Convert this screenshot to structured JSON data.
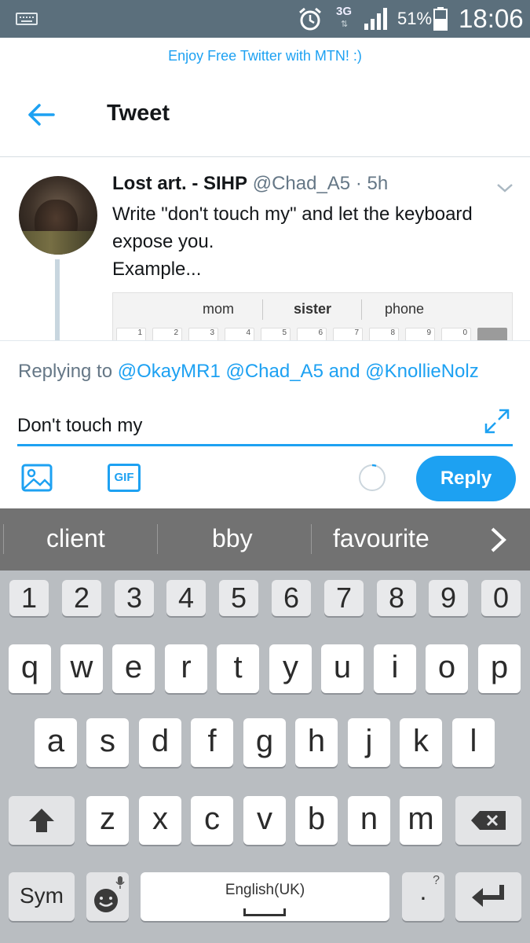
{
  "status_bar": {
    "network": "3G",
    "battery": "51%",
    "time": "18:06"
  },
  "banner": {
    "text": "Enjoy Free Twitter with MTN! :)"
  },
  "header": {
    "title": "Tweet"
  },
  "tweet": {
    "name": "Lost art. - SIHP",
    "handle": "@Chad_A5",
    "time": "5h",
    "lines": [
      "Write \"don't touch my\" and let the keyboard",
      "expose you.",
      "Example..."
    ],
    "image": {
      "suggestions": [
        "mom",
        "sister",
        "phone"
      ],
      "numbers": [
        "1",
        "2",
        "3",
        "4",
        "5",
        "6",
        "7",
        "8",
        "9",
        "0"
      ]
    }
  },
  "compose": {
    "replying_prefix": "Replying to",
    "replying_handles": "@OkayMR1 @Chad_A5 and @KnollieNolz",
    "text": "Don't touch my",
    "gif_label": "GIF",
    "reply_label": "Reply"
  },
  "suggestions": [
    "client",
    "bby",
    "favourite"
  ],
  "keyboard": {
    "numbers": [
      "1",
      "2",
      "3",
      "4",
      "5",
      "6",
      "7",
      "8",
      "9",
      "0"
    ],
    "row1": [
      "q",
      "w",
      "e",
      "r",
      "t",
      "y",
      "u",
      "i",
      "o",
      "p"
    ],
    "row2": [
      "a",
      "s",
      "d",
      "f",
      "g",
      "h",
      "j",
      "k",
      "l"
    ],
    "row3": [
      "z",
      "x",
      "c",
      "v",
      "b",
      "n",
      "m"
    ],
    "sym_label": "Sym",
    "space_label": "English(UK)",
    "period_label": ".",
    "period_hint": "?"
  },
  "colors": {
    "accent": "#1da1f2",
    "status_bar": "#5b6f7c",
    "suggest_bar": "#727272",
    "keyboard_bg": "#b9bdc1"
  },
  "icons": [
    "keyboard-icon",
    "alarm-icon",
    "signal-icon",
    "battery-icon",
    "back-arrow-icon",
    "chevron-down-icon",
    "expand-icon",
    "image-icon",
    "gif-icon",
    "progress-ring-icon",
    "chevron-right-icon",
    "shift-icon",
    "backspace-icon",
    "emoji-icon",
    "microphone-icon",
    "enter-icon"
  ]
}
